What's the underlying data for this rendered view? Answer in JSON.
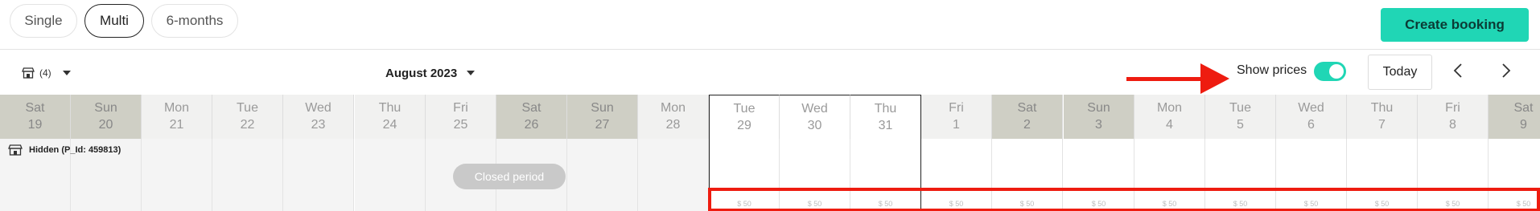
{
  "view_tabs": [
    {
      "label": "Single",
      "active": false
    },
    {
      "label": "Multi",
      "active": true
    },
    {
      "label": "6-months",
      "active": false
    }
  ],
  "create_booking_label": "Create booking",
  "property_filter": {
    "count_label": "(4)",
    "icon": "store-icon"
  },
  "month_label": "August 2023",
  "show_prices": {
    "label": "Show prices",
    "enabled": true
  },
  "today_label": "Today",
  "days": [
    {
      "dow": "Sat",
      "date": "19",
      "weekend": true,
      "past": true
    },
    {
      "dow": "Sun",
      "date": "20",
      "weekend": true,
      "past": true
    },
    {
      "dow": "Mon",
      "date": "21",
      "weekend": false,
      "past": true
    },
    {
      "dow": "Tue",
      "date": "22",
      "weekend": false,
      "past": true
    },
    {
      "dow": "Wed",
      "date": "23",
      "weekend": false,
      "past": true
    },
    {
      "dow": "Thu",
      "date": "24",
      "weekend": false,
      "past": true
    },
    {
      "dow": "Fri",
      "date": "25",
      "weekend": false,
      "past": true
    },
    {
      "dow": "Sat",
      "date": "26",
      "weekend": true,
      "past": true
    },
    {
      "dow": "Sun",
      "date": "27",
      "weekend": true,
      "past": true
    },
    {
      "dow": "Mon",
      "date": "28",
      "weekend": false,
      "past": true
    },
    {
      "dow": "Tue",
      "date": "29",
      "weekend": false,
      "past": false,
      "price": "$ 50"
    },
    {
      "dow": "Wed",
      "date": "30",
      "weekend": false,
      "past": false,
      "price": "$ 50"
    },
    {
      "dow": "Thu",
      "date": "31",
      "weekend": false,
      "past": false,
      "price": "$ 50"
    },
    {
      "dow": "Fri",
      "date": "1",
      "weekend": false,
      "past": false,
      "price": "$ 50"
    },
    {
      "dow": "Sat",
      "date": "2",
      "weekend": true,
      "past": false,
      "price": "$ 50"
    },
    {
      "dow": "Sun",
      "date": "3",
      "weekend": true,
      "past": false,
      "price": "$ 50"
    },
    {
      "dow": "Mon",
      "date": "4",
      "weekend": false,
      "past": false,
      "price": "$ 50"
    },
    {
      "dow": "Tue",
      "date": "5",
      "weekend": false,
      "past": false,
      "price": "$ 50"
    },
    {
      "dow": "Wed",
      "date": "6",
      "weekend": false,
      "past": false,
      "price": "$ 50"
    },
    {
      "dow": "Thu",
      "date": "7",
      "weekend": false,
      "past": false,
      "price": "$ 50"
    },
    {
      "dow": "Fri",
      "date": "8",
      "weekend": false,
      "past": false,
      "price": "$ 50"
    },
    {
      "dow": "Sat",
      "date": "9",
      "weekend": true,
      "past": false,
      "price": "$ 50"
    }
  ],
  "room": {
    "name": "Hidden (P_Id: 459813)",
    "icon": "store-icon"
  },
  "closed_period_label": "Closed period",
  "accent_color": "#20d6b5",
  "annotation_color": "#ee1c10"
}
